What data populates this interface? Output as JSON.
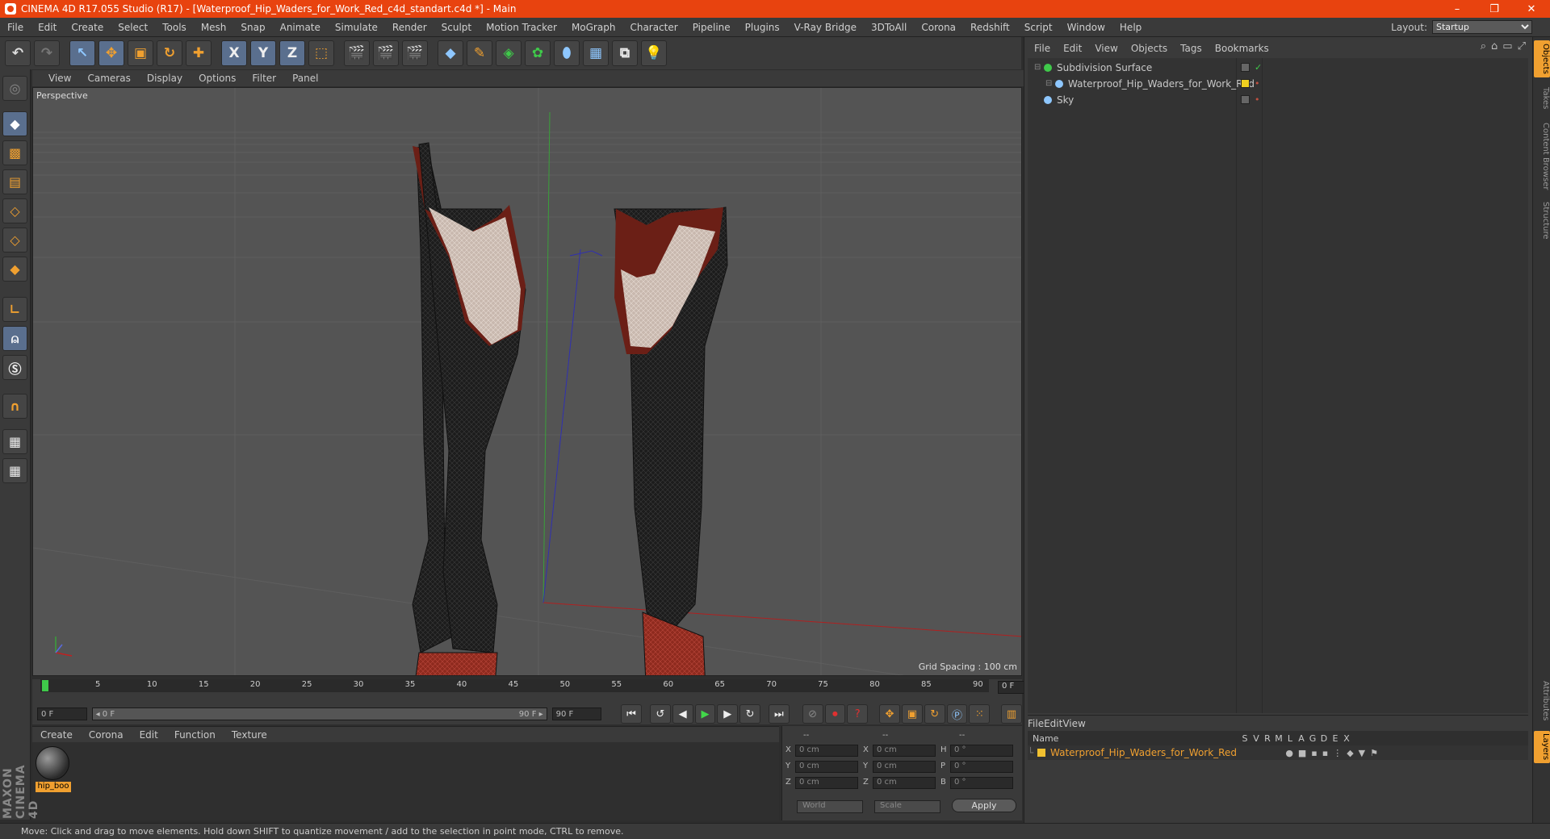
{
  "app": {
    "title": "CINEMA 4D R17.055 Studio (R17) - [Waterproof_Hip_Waders_for_Work_Red_c4d_standart.c4d *] - Main",
    "window_buttons": [
      "–",
      "❐",
      "✕"
    ]
  },
  "menu": [
    "File",
    "Edit",
    "Create",
    "Select",
    "Tools",
    "Mesh",
    "Snap",
    "Animate",
    "Simulate",
    "Render",
    "Sculpt",
    "Motion Tracker",
    "MoGraph",
    "Character",
    "Pipeline",
    "Plugins",
    "V-Ray Bridge",
    "3DToAll",
    "Corona",
    "Redshift",
    "Script",
    "Window",
    "Help"
  ],
  "layout": {
    "label": "Layout:",
    "value": "Startup"
  },
  "toolbar": {
    "undo": "↶",
    "redo": "↷",
    "select": "↖",
    "move": "✥",
    "scale": "▣",
    "rotate": "↻",
    "live": "✚",
    "x": "X",
    "y": "Y",
    "z": "Z",
    "coord": "⬚"
  },
  "viewport": {
    "menu": [
      "View",
      "Cameras",
      "Display",
      "Options",
      "Filter",
      "Panel"
    ],
    "label": "Perspective",
    "grid_spacing": "Grid Spacing : 100 cm"
  },
  "timeline": {
    "ticks": [
      "0",
      "5",
      "10",
      "15",
      "20",
      "25",
      "30",
      "35",
      "40",
      "45",
      "50",
      "55",
      "60",
      "65",
      "70",
      "75",
      "80",
      "85",
      "90"
    ],
    "current_frame": "0 F",
    "start": "0 F",
    "range_start": "◂ 0 F",
    "range_end": "90 F ▸",
    "end": "90 F"
  },
  "materials": {
    "menu": [
      "Create",
      "Corona",
      "Edit",
      "Function",
      "Texture"
    ],
    "items": [
      {
        "name": "hip_boo"
      }
    ]
  },
  "coordinates": {
    "headers": [
      "--",
      "--",
      "--"
    ],
    "rows": [
      {
        "a": "X",
        "av": "0 cm",
        "b": "X",
        "bv": "0 cm",
        "c": "H",
        "cv": "0 °"
      },
      {
        "a": "Y",
        "av": "0 cm",
        "b": "Y",
        "bv": "0 cm",
        "c": "P",
        "cv": "0 °"
      },
      {
        "a": "Z",
        "av": "0 cm",
        "b": "Z",
        "bv": "0 cm",
        "c": "B",
        "cv": "0 °"
      }
    ],
    "world": "World",
    "scale": "Scale",
    "apply": "Apply"
  },
  "object_manager": {
    "menu": [
      "File",
      "Edit",
      "View",
      "Objects",
      "Tags",
      "Bookmarks"
    ],
    "objects": [
      {
        "name": "Subdivision Surface",
        "indent": 0,
        "color": "#3fc94a"
      },
      {
        "name": "Waterproof_Hip_Waders_for_Work_Red",
        "indent": 1,
        "color": "#8ec7ff"
      },
      {
        "name": "Sky",
        "indent": 0,
        "color": "#8ec7ff"
      }
    ]
  },
  "layer_manager": {
    "menu": [
      "File",
      "Edit",
      "View"
    ],
    "columns": [
      "Name",
      "S",
      "V",
      "R",
      "M",
      "L",
      "A",
      "G",
      "D",
      "E",
      "X"
    ],
    "layers": [
      {
        "name": "Waterproof_Hip_Waders_for_Work_Red",
        "color": "#f0c030"
      }
    ]
  },
  "side_tabs": [
    "Objects",
    "Takes",
    "Content Browser",
    "Structure",
    "Attributes",
    "Layers"
  ],
  "status": "Move: Click and drag to move elements. Hold down SHIFT to quantize movement / add to the selection in point mode, CTRL to remove.",
  "brand": "MAXON CINEMA 4D",
  "colors": {
    "accent": "#f0a030",
    "titlebar": "#e8430f"
  }
}
